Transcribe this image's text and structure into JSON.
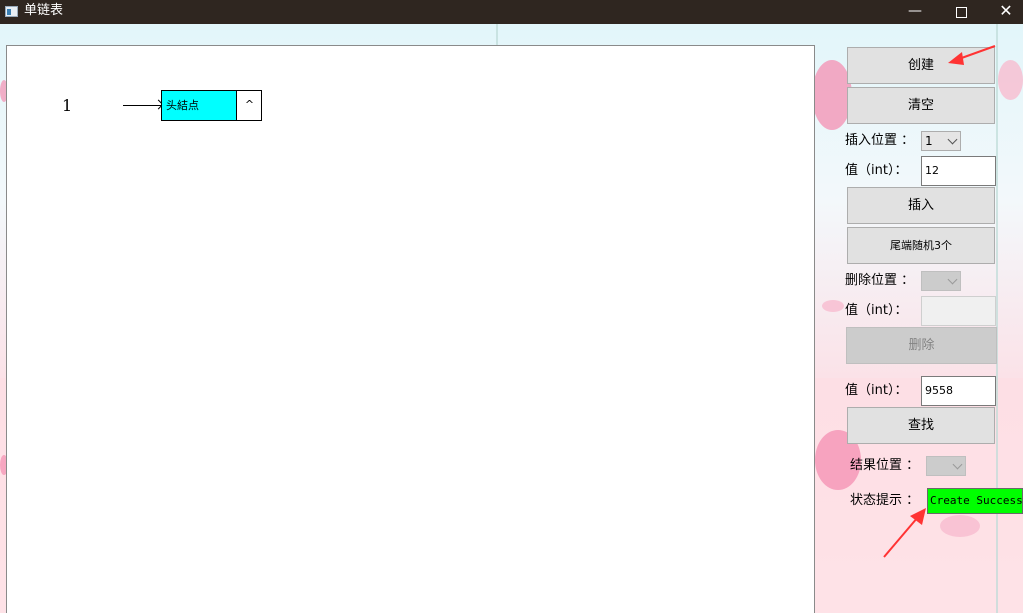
{
  "window": {
    "title": "单链表"
  },
  "list": {
    "index_label": "1",
    "nodes": [
      {
        "data": "头結点",
        "next": "^"
      }
    ]
  },
  "controls": {
    "create_label": "创建",
    "clear_label": "清空",
    "insert_pos_label": "插入位置 ：",
    "insert_pos_value": "1",
    "insert_value_label": "值（int）：",
    "insert_value": "12",
    "insert_label": "插入",
    "tail_random_label": "尾端随机3个",
    "delete_pos_label": "删除位置 ：",
    "delete_value_label": "值（int）：",
    "delete_value": "",
    "delete_label": "删除",
    "find_value_label": "值（int）：",
    "find_value": "9558",
    "find_label": "查找",
    "result_pos_label": "结果位置 ：",
    "status_label": "状态提示 ：",
    "status_text": "Create Success!"
  },
  "colors": {
    "node_data_fill": "#00ffff",
    "status_fill": "#00ff00",
    "annotation_arrow": "#ff3333"
  }
}
